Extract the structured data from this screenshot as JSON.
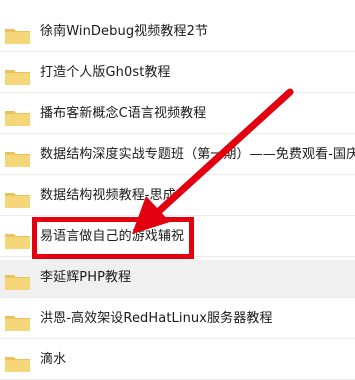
{
  "items": [
    {
      "label": "徐南WinDebug视频教程2节",
      "icon": "folder-icon"
    },
    {
      "label": "打造个人版Gh0st教程",
      "icon": "folder-icon"
    },
    {
      "label": "播布客新概念C语言视频教程",
      "icon": "folder-icon"
    },
    {
      "label": "数据结构深度实战专题班（第一期）——免费观看-国庆",
      "icon": "folder-icon"
    },
    {
      "label": "数据结构视频教程-思成",
      "icon": "folder-icon"
    },
    {
      "label": "易语言做自己的游戏辅祝",
      "icon": "folder-icon"
    },
    {
      "label": "李延辉PHP教程",
      "icon": "folder-icon"
    },
    {
      "label": "洪恩-高效架设RedHatLinux服务器教程",
      "icon": "folder-icon"
    },
    {
      "label": "滴水",
      "icon": "folder-icon"
    }
  ],
  "colors": {
    "folder_body": "#f5d77a",
    "folder_tab": "#e9c25c",
    "annotation_red": "#e3000f"
  },
  "annotation": {
    "highlighted_item_index": 5,
    "shape": "red-box-with-arrow"
  }
}
